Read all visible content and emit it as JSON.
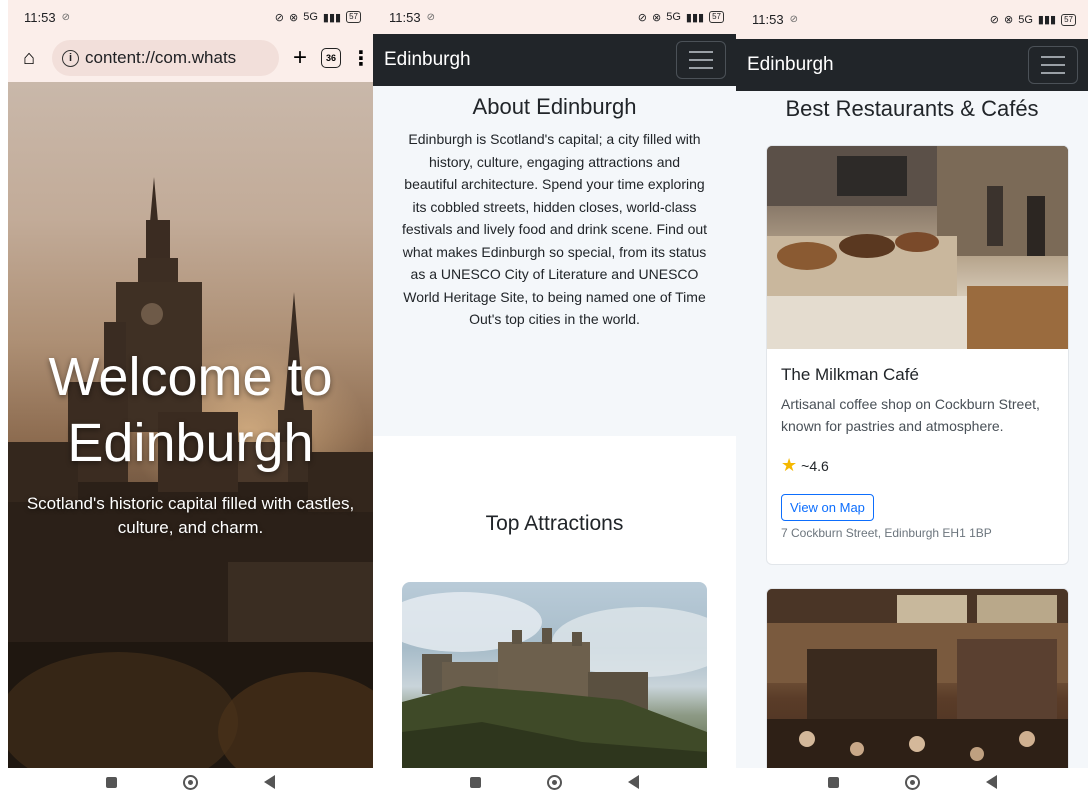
{
  "status_bar": {
    "time": "11:53",
    "battery": "57",
    "network": "5G"
  },
  "browser": {
    "url": "content://com.whats",
    "tab_count": "36"
  },
  "hero": {
    "title": "Welcome to Edinburgh",
    "subtitle": "Scotland's historic capital filled with castles, culture, and charm."
  },
  "navbar": {
    "brand": "Edinburgh"
  },
  "about": {
    "heading": "About Edinburgh",
    "text": "Edinburgh is Scotland's capital; a city filled with history, culture, engaging attractions and beautiful architecture. Spend your time exploring its cobbled streets, hidden closes, world-class festivals and lively food and drink scene. Find out what makes Edinburgh so special, from its status as a UNESCO City of Literature and UNESCO World Heritage Site, to being named one of Time Out's top cities in the world."
  },
  "attractions": {
    "heading": "Top Attractions"
  },
  "restaurants": {
    "heading": "Best Restaurants & Cafés",
    "items": [
      {
        "name": "The Milkman Café",
        "description": "Artisanal coffee shop on Cockburn Street, known for pastries and atmosphere.",
        "rating": "~4.6",
        "button": "View on Map",
        "address": "7 Cockburn Street, Edinburgh EH1 1BP"
      }
    ]
  },
  "icons": [
    "home-icon",
    "info-icon",
    "plus-icon",
    "tabs-icon",
    "more-vert-icon",
    "menu-icon",
    "star-icon",
    "recents-icon",
    "home-nav-icon",
    "back-icon"
  ]
}
